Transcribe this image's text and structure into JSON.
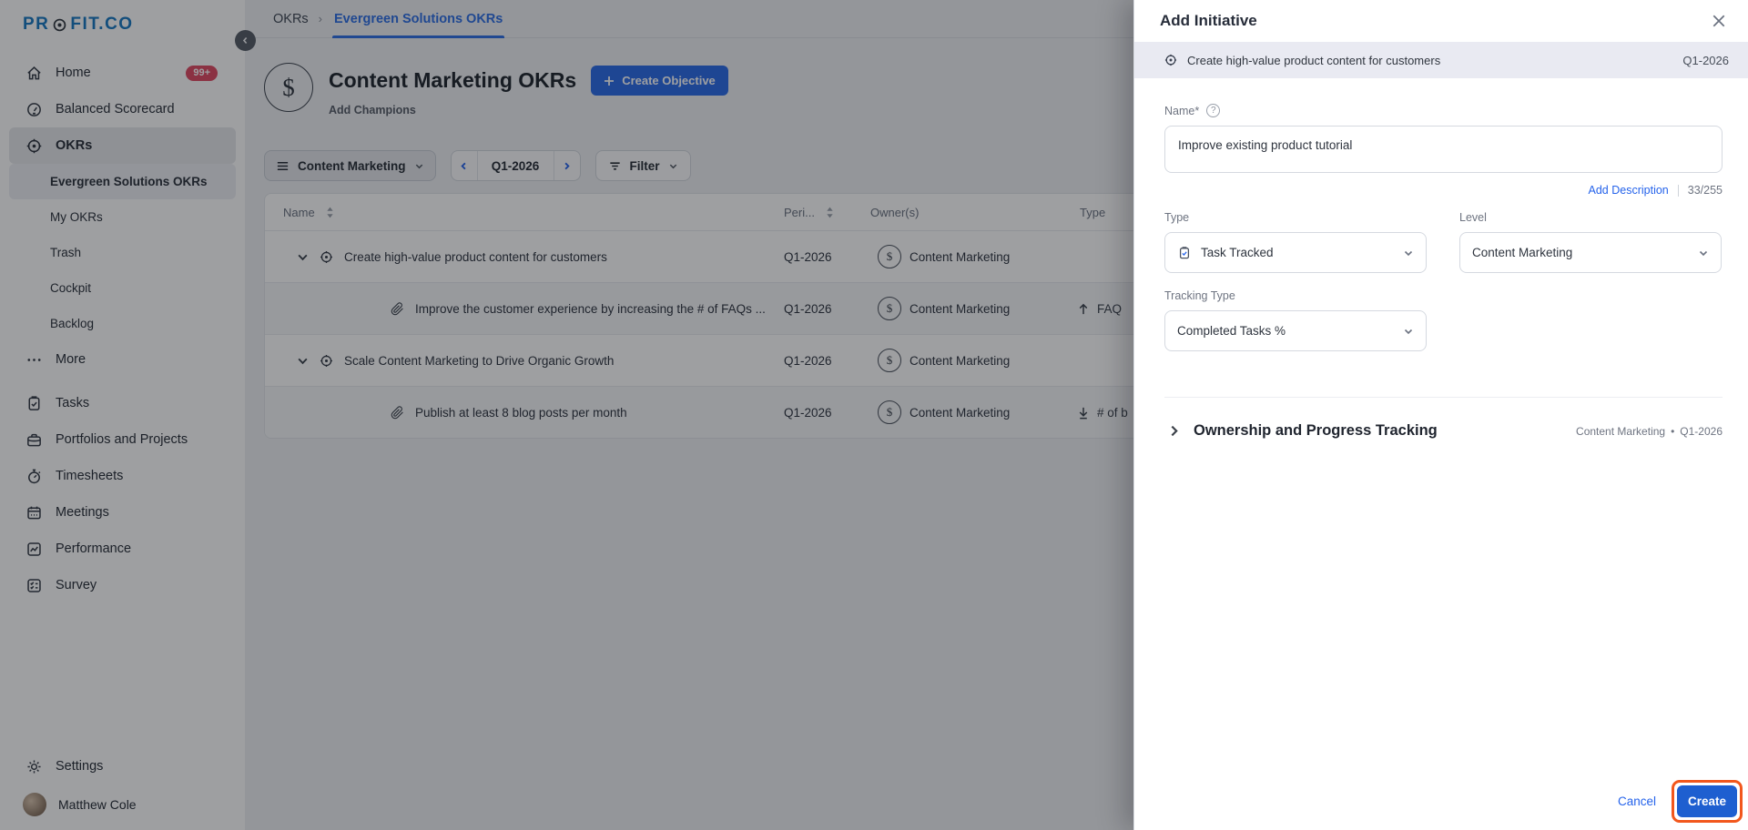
{
  "brand": {
    "logo_pre": "PR",
    "logo_post": "FIT.CO"
  },
  "icons": {
    "dollar": "$",
    "question_mark": "?",
    "close": "×"
  },
  "sidebar": {
    "primary": [
      {
        "label": "Home",
        "badge": "99+"
      },
      {
        "label": "Balanced Scorecard"
      },
      {
        "label": "OKRs"
      }
    ],
    "okr_children": [
      {
        "label": "Evergreen Solutions OKRs"
      },
      {
        "label": "My OKRs"
      },
      {
        "label": "Trash"
      },
      {
        "label": "Cockpit"
      },
      {
        "label": "Backlog"
      }
    ],
    "more_label": "More",
    "secondary": [
      {
        "label": "Tasks"
      },
      {
        "label": "Portfolios and Projects"
      },
      {
        "label": "Timesheets"
      },
      {
        "label": "Meetings"
      },
      {
        "label": "Performance"
      },
      {
        "label": "Survey"
      }
    ],
    "settings_label": "Settings",
    "user_name": "Matthew Cole"
  },
  "breadcrumb": {
    "root": "OKRs",
    "separator": "›",
    "current": "Evergreen Solutions OKRs"
  },
  "page": {
    "title": "Content Marketing OKRs",
    "create_objective_label": "Create Objective",
    "add_champions": "Add Champions"
  },
  "toolbar": {
    "team_selector": "Content Marketing",
    "period": "Q1-2026",
    "filter_label": "Filter"
  },
  "table": {
    "columns": [
      {
        "label": "Name"
      },
      {
        "label": "Peri..."
      },
      {
        "label": "Owner(s)"
      },
      {
        "label": "Type"
      }
    ],
    "rows": [
      {
        "kind": "objective",
        "name": "Create high-value product content for customers",
        "period": "Q1-2026",
        "owner": "Content Marketing",
        "type_label": ""
      },
      {
        "kind": "initiative",
        "name": "Improve the customer experience by increasing the # of FAQs ...",
        "period": "Q1-2026",
        "owner": "Content Marketing",
        "type_label": "FAQ"
      },
      {
        "kind": "objective",
        "name": "Scale Content Marketing to Drive Organic Growth",
        "period": "Q1-2026",
        "owner": "Content Marketing",
        "type_label": ""
      },
      {
        "kind": "initiative",
        "name": "Publish at least 8 blog posts per month",
        "period": "Q1-2026",
        "owner": "Content Marketing",
        "type_label": "# of b"
      }
    ]
  },
  "panel": {
    "title": "Add Initiative",
    "parent_objective": {
      "name": "Create high-value product content for customers",
      "period": "Q1-2026"
    },
    "form": {
      "name_label": "Name*",
      "name_value": "Improve existing product tutorial",
      "add_description_label": "Add Description",
      "char_counter": "33/255",
      "type_label": "Type",
      "type_value": "Task Tracked",
      "level_label": "Level",
      "level_value": "Content Marketing",
      "tracking_type_label": "Tracking Type",
      "tracking_type_value": "Completed Tasks %"
    },
    "ownership_section": {
      "title": "Ownership and Progress Tracking",
      "team": "Content Marketing",
      "bullet": "•",
      "period": "Q1-2026"
    },
    "footer": {
      "cancel_label": "Cancel",
      "create_label": "Create"
    }
  },
  "colors": {
    "primary_blue": "#2b6be8",
    "panel_create_blue": "#1e5fd0",
    "tab_blue": "#2e6fe4",
    "badge_red": "#e04a63",
    "highlight_orange": "#f2571c",
    "objective_bar_bg": "#e9eaf2"
  }
}
